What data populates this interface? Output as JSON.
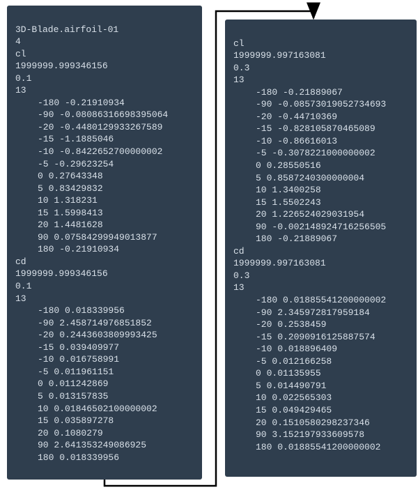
{
  "header": {
    "title": "3D-Blade.airfoil-01",
    "count": "4"
  },
  "left": {
    "cl": {
      "label": "cl",
      "big": "1999999.999346156",
      "ratio": "0.1",
      "n": "13",
      "rows": [
        "-180 -0.21910934",
        "-90 -0.08086316698395064",
        "-20 -0.4480129933267589",
        "-15 -1.1885046",
        "-10 -0.8422652700000002",
        "-5 -0.29623254",
        "0 0.27643348",
        "5 0.83429832",
        "10 1.318231",
        "15 1.5998413",
        "20 1.4481628",
        "90 0.07584299949013877",
        "180 -0.21910934"
      ]
    },
    "cd": {
      "label": "cd",
      "big": "1999999.999346156",
      "ratio": "0.1",
      "n": "13",
      "rows": [
        "-180 0.018339956",
        "-90 2.458714976851852",
        "-20 0.2443603809993425",
        "-15 0.039409977",
        "-10 0.016758991",
        "-5 0.011961151",
        "0 0.011242869",
        "5 0.013157835",
        "10 0.01846502100000002",
        "15 0.035897278",
        "20 0.1080279",
        "90 2.641353249086925",
        "180 0.018339956"
      ]
    }
  },
  "right": {
    "cl": {
      "label": "cl",
      "big": "1999999.997163081",
      "ratio": "0.3",
      "n": "13",
      "rows": [
        "-180 -0.21889067",
        "-90 -0.08573019052734693",
        "-20 -0.44710369",
        "-15 -0.828105870465089",
        "-10 -0.86616013",
        "-5 -0.3078221000000002",
        "0 0.28550516",
        "5 0.8587240300000004",
        "10 1.3400258",
        "15 1.5502243",
        "20 1.226524029031954",
        "90 -0.002148924716256505",
        "180 -0.21889067"
      ]
    },
    "cd": {
      "label": "cd",
      "big": "1999999.997163081",
      "ratio": "0.3",
      "n": "13",
      "rows": [
        "-180 0.01885541200000002",
        "-90 2.345972817959184",
        "-20 0.2538459",
        "-15 0.2090916125887574",
        "-10 0.018896409",
        "-5 0.012166258",
        "0 0.01135955",
        "5 0.014490791",
        "10 0.022565303",
        "15 0.049429465",
        "20 0.1510580298237346",
        "90 3.152197933609578",
        "180 0.01885541200000002"
      ]
    }
  }
}
